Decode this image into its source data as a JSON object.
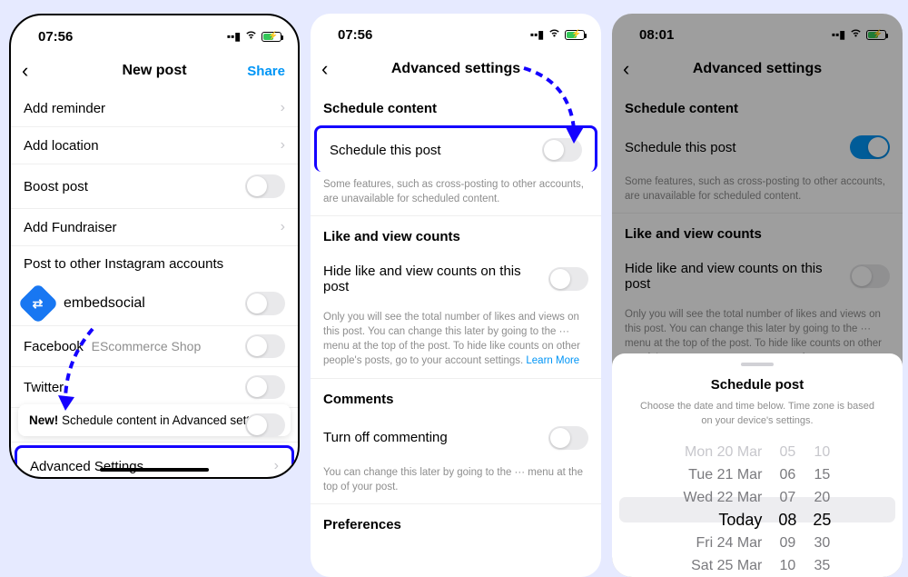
{
  "screen1": {
    "time": "07:56",
    "title": "New post",
    "share": "Share",
    "rows": {
      "reminder": "Add reminder",
      "location": "Add location",
      "boost": "Boost post",
      "fundraiser": "Add Fundraiser",
      "crosspost_head": "Post to other Instagram accounts",
      "account_name": "embedsocial",
      "facebook": "Facebook",
      "facebook_sub": "EScommerce Shop",
      "twitter": "Twitter",
      "banner_new": "New!",
      "banner_text": "Schedule content in Advanced settings.",
      "advanced": "Advanced Settings"
    }
  },
  "screen2": {
    "time": "07:56",
    "title": "Advanced settings",
    "sections": {
      "schedule_head": "Schedule content",
      "schedule_row": "Schedule this post",
      "schedule_desc": "Some features, such as cross-posting to other accounts, are unavailable for scheduled content.",
      "likes_head": "Like and view counts",
      "likes_row": "Hide like and view counts on this post",
      "likes_desc": "Only you will see the total number of likes and views on this post. You can change this later by going to the ··· menu at the top of the post. To hide like counts on other people's posts, go to your account settings. ",
      "likes_learn": "Learn More",
      "comments_head": "Comments",
      "comments_row": "Turn off commenting",
      "comments_desc": "You can change this later by going to the ··· menu at the top of your post.",
      "prefs_head": "Preferences"
    }
  },
  "screen3": {
    "time": "08:01",
    "title": "Advanced settings",
    "sheet": {
      "title": "Schedule post",
      "desc": "Choose the date and time below. Time zone is based on your device's settings.",
      "days": [
        "Mon 20 Mar",
        "Tue 21 Mar",
        "Wed 22 Mar",
        "Today",
        "Fri 24 Mar",
        "Sat 25 Mar"
      ],
      "hours": [
        "05",
        "06",
        "07",
        "08",
        "09",
        "10"
      ],
      "minutes": [
        "10",
        "15",
        "20",
        "25",
        "30",
        "35"
      ]
    }
  }
}
